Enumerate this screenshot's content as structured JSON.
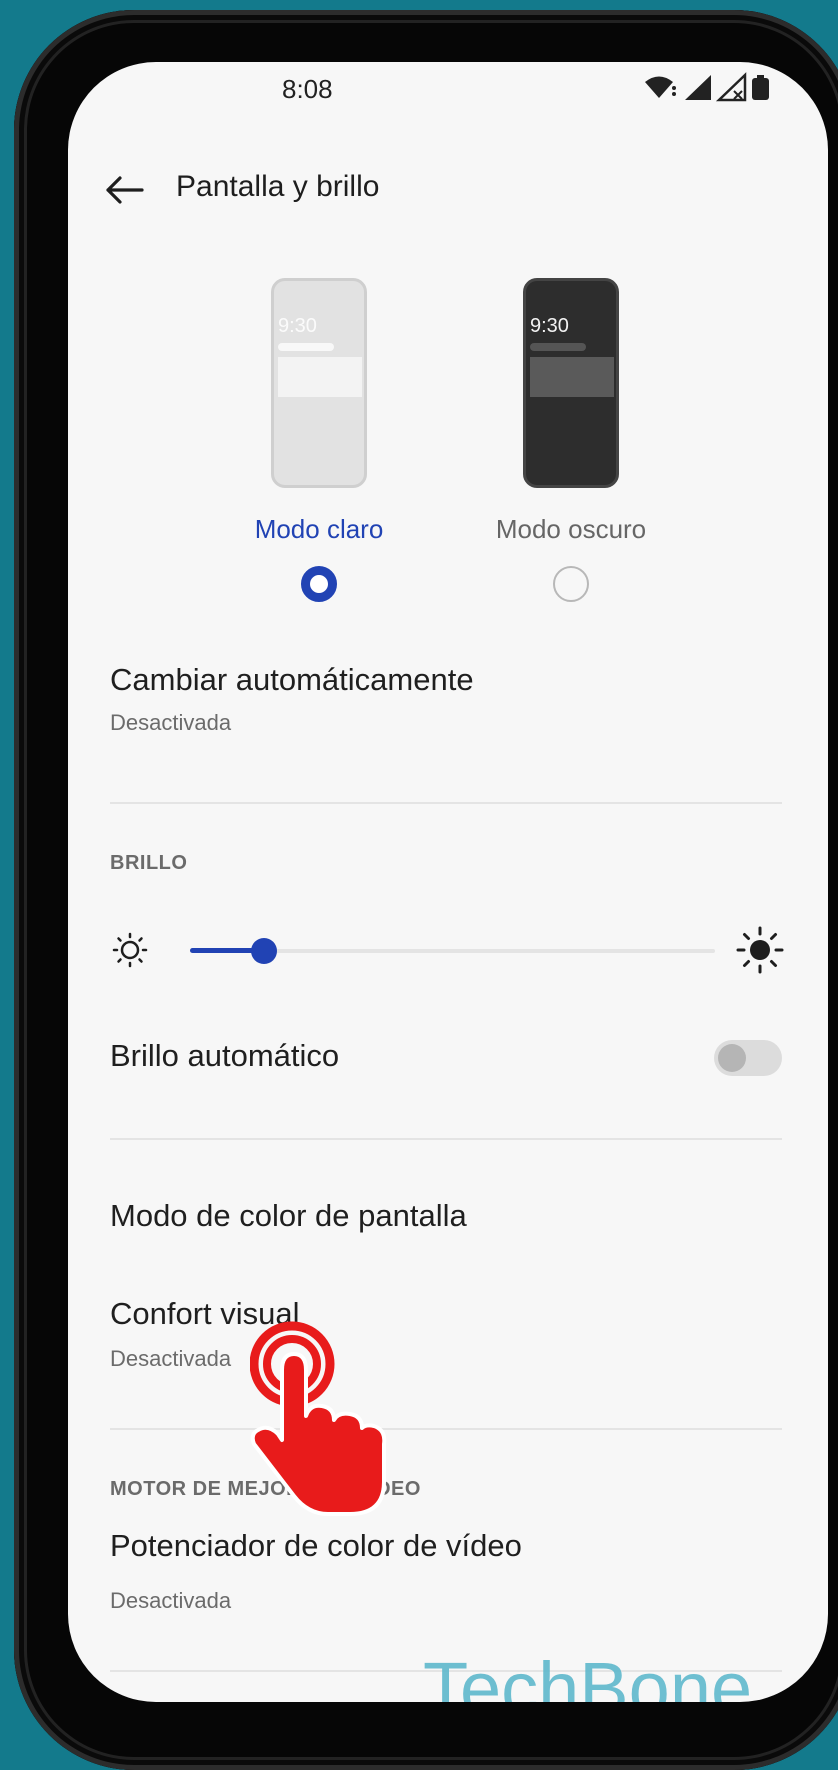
{
  "status_bar": {
    "time": "8:08"
  },
  "header": {
    "title": "Pantalla y brillo"
  },
  "theme_modes": {
    "light": {
      "label": "Modo claro",
      "preview_time": "9:30",
      "selected": true
    },
    "dark": {
      "label": "Modo oscuro",
      "preview_time": "9:30",
      "selected": false
    }
  },
  "auto_switch": {
    "title": "Cambiar automáticamente",
    "subtitle": "Desactivada"
  },
  "brightness": {
    "section_label": "BRILLO",
    "level": 0.14,
    "auto_title": "Brillo automático",
    "auto_enabled": false
  },
  "color_mode": {
    "title": "Modo de color de pantalla"
  },
  "eye_comfort": {
    "title": "Confort visual",
    "subtitle": "Desactivada"
  },
  "video_engine": {
    "section_label": "MOTOR DE MEJORA DE VÍDEO",
    "booster_title": "Potenciador de color de vídeo",
    "booster_subtitle": "Desactivada"
  },
  "watermark": "TechBone",
  "colors": {
    "accent": "#2143b4",
    "background": "#f7f7f7",
    "frame_bg": "#137a8c",
    "pointer": "#e81b1b"
  }
}
